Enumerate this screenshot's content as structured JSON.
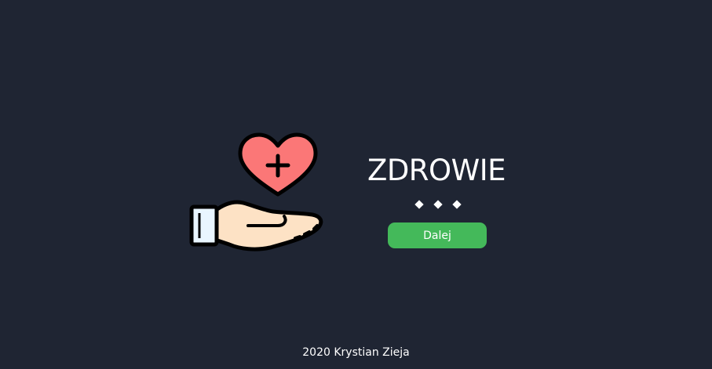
{
  "hero": {
    "icon": "heart-plus-in-hand-icon",
    "title": "ZDROWIE",
    "divider_icon": "three-diamonds-divider"
  },
  "actions": {
    "next_label": "Dalej"
  },
  "footer": {
    "text": "2020 Krystian Zieja"
  },
  "colors": {
    "background": "#1f2533",
    "accent_green": "#44b95a",
    "heart": "#fb7777",
    "skin": "#fde2c5",
    "cuff": "#e9f5ff",
    "outline": "#000000"
  }
}
